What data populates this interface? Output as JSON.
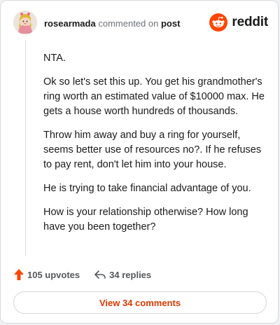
{
  "comment": {
    "username": "rosearmada",
    "action_text": "commented on",
    "post_link": "post",
    "paragraphs": [
      "NTA.",
      "Ok so let's set this up. You get his grandmother's ring worth an estimated value of $10000 max. He gets a house worth hundreds of thousands.",
      "Throw him away and buy a ring for yourself, seems better use of resources no?. If he refuses to pay rent, don't let him into your house.",
      "He is trying to take financial advantage of you.",
      "How is your relationship otherwise? How long have you been together?"
    ]
  },
  "brand": {
    "name": "reddit",
    "color": "#ff4500"
  },
  "actions": {
    "upvotes_label": "105 upvotes",
    "replies_label": "34 replies"
  },
  "footer": {
    "view_comments_label": "View 34 comments",
    "accent_color": "#d93a00"
  },
  "icons": [
    "avatar",
    "reddit-logo-icon",
    "upvote-icon",
    "reply-icon"
  ]
}
